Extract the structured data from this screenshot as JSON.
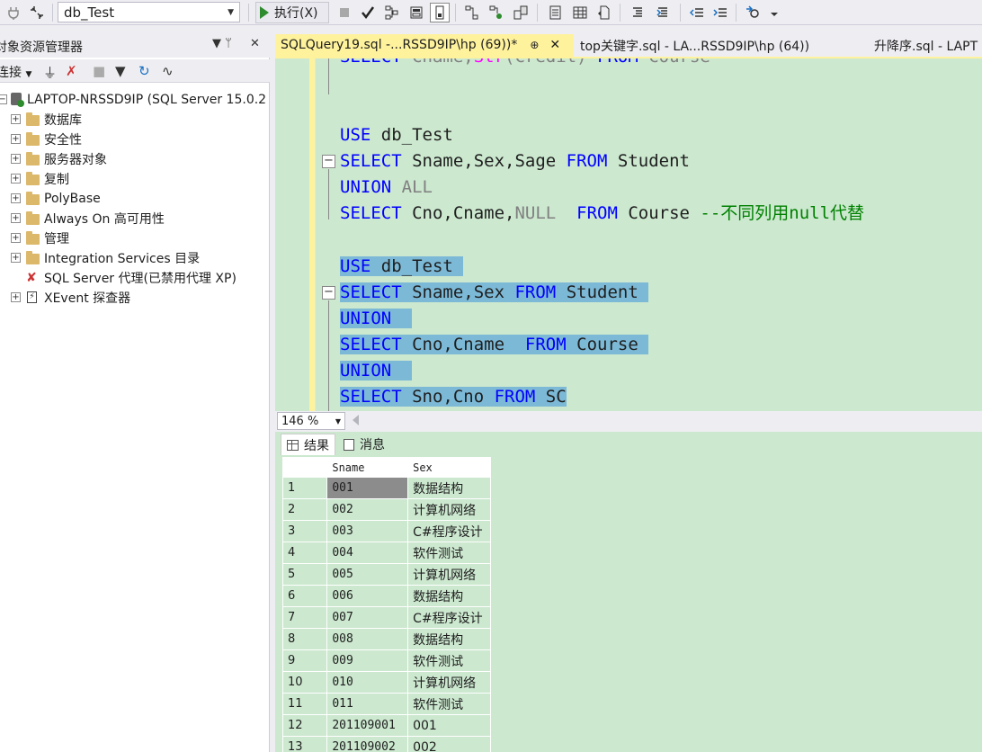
{
  "toolbar": {
    "database": "db_Test",
    "execute_label": "执行(X)"
  },
  "object_explorer": {
    "title": "对象资源管理器",
    "pin_glyph": "▼ ᛘ",
    "close_glyph": "✕",
    "connect_label": "连接",
    "server": "LAPTOP-NRSSD9IP (SQL Server 15.0.2",
    "nodes": [
      "数据库",
      "安全性",
      "服务器对象",
      "复制",
      "PolyBase",
      "Always On 高可用性",
      "管理",
      "Integration Services 目录"
    ],
    "agent": "SQL Server 代理(已禁用代理 XP)",
    "xevent": "XEvent 探查器"
  },
  "tabs": [
    {
      "label": "SQLQuery19.sql -...RSSD9IP\\hp (69))*",
      "pin": "⊕",
      "close": "✕"
    },
    {
      "label": "top关键字.sql - LA...RSSD9IP\\hp (64))"
    },
    {
      "label": "升降序.sql - LAPT"
    }
  ],
  "editor": {
    "line0": [
      "SELECT",
      " Cname,",
      "Str",
      "(Credit) ",
      "FROM",
      " Course"
    ],
    "line1": [
      "USE",
      " db_Test"
    ],
    "line2": [
      "SELECT",
      " Sname,Sex,Sage ",
      "FROM",
      " Student"
    ],
    "line3": [
      "UNION",
      " ALL"
    ],
    "line4": [
      "SELECT",
      " Cno,Cname,",
      "NULL",
      "  ",
      "FROM",
      " Course ",
      "--不同列用null代替"
    ],
    "line5": [
      "USE",
      " db_Test "
    ],
    "line6": [
      "SELECT",
      " Sname,Sex ",
      "FROM",
      " Student "
    ],
    "line7": [
      "UNION",
      "  "
    ],
    "line8": [
      "SELECT",
      " Cno,Cname  ",
      "FROM",
      " Course "
    ],
    "line9": [
      "UNION",
      "  "
    ],
    "line10": [
      "SELECT",
      " Sno,Cno ",
      "FROM",
      " SC"
    ]
  },
  "zoom": "146 %",
  "results": {
    "tab_results": "结果",
    "tab_messages": "消息",
    "columns": [
      "Sname",
      "Sex"
    ],
    "rows": [
      [
        "1",
        "001",
        "数据结构"
      ],
      [
        "2",
        "002",
        "计算机网络"
      ],
      [
        "3",
        "003",
        "C#程序设计"
      ],
      [
        "4",
        "004",
        "软件测试"
      ],
      [
        "5",
        "005",
        "计算机网络"
      ],
      [
        "6",
        "006",
        "数据结构"
      ],
      [
        "7",
        "007",
        "C#程序设计"
      ],
      [
        "8",
        "008",
        "数据结构"
      ],
      [
        "9",
        "009",
        "软件测试"
      ],
      [
        "10",
        "010",
        "计算机网络"
      ],
      [
        "11",
        "011",
        "软件测试"
      ],
      [
        "12",
        "201109001",
        "001"
      ],
      [
        "13",
        "201109002",
        "002"
      ]
    ]
  }
}
